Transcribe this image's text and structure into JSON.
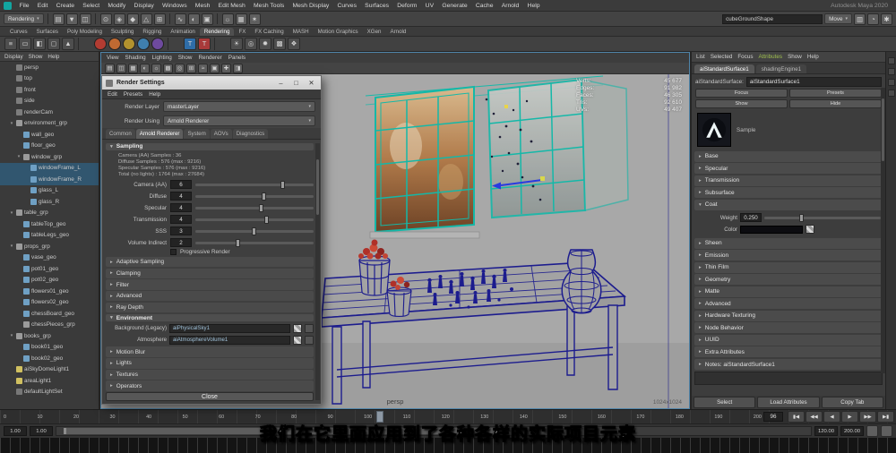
{
  "window": {
    "right_text": "Autodesk Maya 2020"
  },
  "subtitle": {
    "text": "我们在它里面应用到了各种各样的实际项目元素"
  },
  "menubar": {
    "items": [
      "File",
      "Edit",
      "Create",
      "Select",
      "Modify",
      "Display",
      "Windows",
      "Mesh",
      "Edit Mesh",
      "Mesh Tools",
      "Mesh Display",
      "Curves",
      "Surfaces",
      "Deform",
      "UV",
      "Generate",
      "Cache",
      "Arnold",
      "Help"
    ]
  },
  "statusline": {
    "menuset": "Rendering",
    "icons": [
      {
        "g": "▤",
        "c": "#5f5f5f"
      },
      {
        "g": "▼",
        "c": "#5f5f5f"
      },
      {
        "g": "◫",
        "c": "#5f5f5f"
      },
      {
        "cls": "sep"
      },
      {
        "g": "⊙",
        "c": "#5f5f5f"
      },
      {
        "g": "◈",
        "c": "#5f5f5f"
      },
      {
        "g": "◆",
        "c": "#5f5f5f"
      },
      {
        "g": "△",
        "c": "#5f5f5f"
      },
      {
        "g": "⊞",
        "c": "#5f5f5f"
      },
      {
        "cls": "sep"
      },
      {
        "g": "∿",
        "c": "#5f5f5f"
      },
      {
        "g": "◐",
        "c": "#5f5f5f"
      },
      {
        "g": "▣",
        "c": "#5f5f5f"
      },
      {
        "cls": "sep"
      },
      {
        "g": "☼",
        "c": "#5f5f5f"
      },
      {
        "g": "▦",
        "c": "#5f5f5f"
      },
      {
        "g": "✶",
        "c": "#5f5f5f"
      }
    ],
    "field_value": "cubeGroundShape",
    "tool_value": "Move",
    "icons2": [
      {
        "g": "▥",
        "c": "#5f5f5f"
      },
      {
        "g": "◔",
        "c": "#5f5f5f"
      },
      {
        "g": "✱",
        "c": "#5f5f5f"
      }
    ]
  },
  "shelf": {
    "tabs": [
      {
        "label": "Curves"
      },
      {
        "label": "Surfaces"
      },
      {
        "label": "Poly Modeling"
      },
      {
        "label": "Sculpting"
      },
      {
        "label": "Rigging"
      },
      {
        "label": "Animation"
      },
      {
        "label": "Rendering",
        "cls": "active"
      },
      {
        "label": "FX"
      },
      {
        "label": "FX Caching"
      },
      {
        "label": "MASH"
      },
      {
        "label": "Motion Graphics"
      },
      {
        "label": "XGen"
      },
      {
        "label": "Arnold"
      }
    ],
    "icons": [
      {
        "g": "≡",
        "c": "#4e4e4e"
      },
      {
        "g": "▭",
        "c": "#4e4e4e"
      },
      {
        "g": "◧",
        "c": "#4e4e4e"
      },
      {
        "g": "◻",
        "c": "#4e4e4e"
      },
      {
        "g": "▲",
        "c": "#4e4e4e"
      },
      {
        "cls": "sep"
      },
      {
        "g": "",
        "c": "#b23c32",
        "cls": "round"
      },
      {
        "g": "",
        "c": "#c06a32",
        "cls": "round"
      },
      {
        "g": "",
        "c": "#b2922e",
        "cls": "round"
      },
      {
        "g": "",
        "c": "#3f7fae",
        "cls": "round"
      },
      {
        "g": "",
        "c": "#6e4a9e",
        "cls": "round"
      },
      {
        "cls": "sep"
      },
      {
        "g": "T",
        "c": "#2f6da8"
      },
      {
        "g": "T",
        "c": "#a83a3a"
      },
      {
        "cls": "sep"
      },
      {
        "g": "☀",
        "c": "#4e4e4e"
      },
      {
        "g": "◎",
        "c": "#4e4e4e"
      },
      {
        "g": "✹",
        "c": "#4e4e4e"
      },
      {
        "g": "▩",
        "c": "#4e4e4e"
      },
      {
        "g": "❖",
        "c": "#4e4e4e"
      }
    ]
  },
  "outliner": {
    "menus": [
      "Display",
      "Show",
      "Help"
    ],
    "items": [
      {
        "label": "persp",
        "type": "camera",
        "ind": "6px",
        "tw": ""
      },
      {
        "label": "top",
        "type": "camera",
        "ind": "6px",
        "tw": ""
      },
      {
        "label": "front",
        "type": "camera",
        "ind": "6px",
        "tw": ""
      },
      {
        "label": "side",
        "type": "camera",
        "ind": "6px",
        "tw": ""
      },
      {
        "label": "renderCam",
        "type": "camera",
        "ind": "6px",
        "tw": ""
      },
      {
        "label": "environment_grp",
        "type": "transform",
        "ind": "6px",
        "tw": "▾"
      },
      {
        "label": "wall_geo",
        "type": "mesh",
        "ind": "14px",
        "tw": ""
      },
      {
        "label": "floor_geo",
        "type": "mesh",
        "ind": "14px",
        "tw": ""
      },
      {
        "label": "window_grp",
        "type": "transform",
        "ind": "14px",
        "tw": "▾"
      },
      {
        "label": "windowFrame_L",
        "type": "mesh",
        "ind": "22px",
        "tw": "",
        "cls": "sel"
      },
      {
        "label": "windowFrame_R",
        "type": "mesh",
        "ind": "22px",
        "tw": "",
        "cls": "sel"
      },
      {
        "label": "glass_L",
        "type": "mesh",
        "ind": "22px",
        "tw": ""
      },
      {
        "label": "glass_R",
        "type": "mesh",
        "ind": "22px",
        "tw": ""
      },
      {
        "label": "table_grp",
        "type": "transform",
        "ind": "6px",
        "tw": "▾"
      },
      {
        "label": "tableTop_geo",
        "type": "mesh",
        "ind": "14px",
        "tw": ""
      },
      {
        "label": "tableLegs_geo",
        "type": "mesh",
        "ind": "14px",
        "tw": ""
      },
      {
        "label": "props_grp",
        "type": "transform",
        "ind": "6px",
        "tw": "▾"
      },
      {
        "label": "vase_geo",
        "type": "mesh",
        "ind": "14px",
        "tw": ""
      },
      {
        "label": "pot01_geo",
        "type": "mesh",
        "ind": "14px",
        "tw": ""
      },
      {
        "label": "pot02_geo",
        "type": "mesh",
        "ind": "14px",
        "tw": ""
      },
      {
        "label": "flowers01_geo",
        "type": "mesh",
        "ind": "14px",
        "tw": ""
      },
      {
        "label": "flowers02_geo",
        "type": "mesh",
        "ind": "14px",
        "tw": ""
      },
      {
        "label": "chessBoard_geo",
        "type": "mesh",
        "ind": "14px",
        "tw": ""
      },
      {
        "label": "chessPieces_grp",
        "type": "transform",
        "ind": "14px",
        "tw": ""
      },
      {
        "label": "books_grp",
        "type": "transform",
        "ind": "6px",
        "tw": "▾"
      },
      {
        "label": "book01_geo",
        "type": "mesh",
        "ind": "14px",
        "tw": ""
      },
      {
        "label": "book02_geo",
        "type": "mesh",
        "ind": "14px",
        "tw": ""
      },
      {
        "label": "aiSkyDomeLight1",
        "type": "light",
        "ind": "6px",
        "tw": ""
      },
      {
        "label": "areaLight1",
        "type": "light",
        "ind": "6px",
        "tw": ""
      },
      {
        "label": "defaultLightSet",
        "type": "set",
        "ind": "6px",
        "tw": ""
      }
    ]
  },
  "render_settings": {
    "title": "Render Settings",
    "min": "–",
    "max": "□",
    "close": "✕",
    "menus": [
      "Edit",
      "Presets",
      "Help"
    ],
    "layer_label": "Render Layer",
    "layer_value": "masterLayer",
    "using_label": "Render Using",
    "using_value": "Arnold Renderer",
    "tabs": [
      {
        "label": "Common"
      },
      {
        "label": "Arnold Renderer",
        "cls": "active"
      },
      {
        "label": "System"
      },
      {
        "label": "AOVs"
      },
      {
        "label": "Diagnostics"
      }
    ],
    "sampling_header": "Sampling",
    "summary": [
      "Camera (AA) Samples : 36",
      "Diffuse Samples : 576 (max : 9216)",
      "Specular Samples : 576 (max : 9216)",
      "Total (no lights) : 1764 (max : 27684)"
    ],
    "sliders": [
      {
        "label": "Camera (AA)",
        "value": "6",
        "pos": "72%"
      },
      {
        "label": "Diffuse",
        "value": "4",
        "pos": "56%"
      },
      {
        "label": "Specular",
        "value": "4",
        "pos": "54%"
      },
      {
        "label": "Transmission",
        "value": "4",
        "pos": "58%"
      },
      {
        "label": "SSS",
        "value": "3",
        "pos": "48%"
      },
      {
        "label": "Volume Indirect",
        "value": "2",
        "pos": "34%"
      }
    ],
    "progressive_label": "Progressive Render",
    "sections_a": [
      {
        "label": "Adaptive Sampling"
      },
      {
        "label": "Clamping"
      },
      {
        "label": "Filter"
      },
      {
        "label": "Advanced"
      },
      {
        "label": "Ray Depth"
      }
    ],
    "environment_header": "Environment",
    "env_rows": [
      {
        "label": "Background (Legacy)",
        "value": "aiPhysicalSky1"
      },
      {
        "label": "Atmosphere",
        "value": "aiAtmosphereVolume1"
      }
    ],
    "sections_b": [
      {
        "label": "Motion Blur"
      },
      {
        "label": "Lights"
      },
      {
        "label": "Textures"
      },
      {
        "label": "Operators"
      }
    ],
    "close_label": "Close"
  },
  "viewport": {
    "menus": [
      "View",
      "Shading",
      "Lighting",
      "Show",
      "Renderer",
      "Panels"
    ],
    "icons": [
      {
        "g": "▤"
      },
      {
        "g": "◫"
      },
      {
        "g": "▦"
      },
      {
        "g": "◐"
      },
      {
        "g": "☼"
      },
      {
        "g": "▩"
      },
      {
        "g": "◎"
      },
      {
        "g": "⊞"
      },
      {
        "g": "≈"
      },
      {
        "g": "▣"
      },
      {
        "g": "✚"
      },
      {
        "g": "◨"
      }
    ],
    "hud": [
      {
        "label": "Verts:",
        "value": "45 677"
      },
      {
        "label": "Edges:",
        "value": "91 982"
      },
      {
        "label": "Faces:",
        "value": "46 305"
      },
      {
        "label": "Tris:",
        "value": "92 610"
      },
      {
        "label": "UVs:",
        "value": "49 407"
      }
    ],
    "camera_label": "persp",
    "gate_label": "1024x1024"
  },
  "attribute_editor": {
    "menus": [
      {
        "label": "List"
      },
      {
        "label": "Selected"
      },
      {
        "label": "Focus"
      },
      {
        "label": "Attributes",
        "cls": "green"
      },
      {
        "label": "Show"
      },
      {
        "label": "Help"
      }
    ],
    "tabs": [
      {
        "label": "aiStandardSurface1",
        "cls": "active"
      },
      {
        "label": "shadingEngine1"
      }
    ],
    "name_label": "aiStandardSurface:",
    "name_value": "aiStandardSurface1",
    "buttons": [
      "Focus",
      "Presets",
      "Show",
      "Hide"
    ],
    "swatch_label": "Sample",
    "sections_a": [
      {
        "label": "Base"
      },
      {
        "label": "Specular"
      },
      {
        "label": "Transmission"
      },
      {
        "label": "Subsurface"
      }
    ],
    "expanded_label": "Coat",
    "weight_label": "Weight",
    "weight_value": "0.250",
    "weight_pos": "30%",
    "color_label": "Color",
    "sections_b": [
      {
        "label": "Sheen"
      },
      {
        "label": "Emission"
      },
      {
        "label": "Thin Film"
      },
      {
        "label": "Geometry"
      },
      {
        "label": "Matte"
      },
      {
        "label": "Advanced"
      },
      {
        "label": "Hardware Texturing"
      },
      {
        "label": "Node Behavior"
      },
      {
        "label": "UUID"
      },
      {
        "label": "Extra Attributes"
      }
    ],
    "notes_label": "Notes: aiStandardSurface1",
    "footer": [
      "Select",
      "Load Attributes",
      "Copy Tab"
    ]
  },
  "timeline": {
    "ticks": [
      "0",
      "10",
      "20",
      "30",
      "40",
      "50",
      "60",
      "70",
      "80",
      "90",
      "100",
      "110",
      "120",
      "130",
      "140",
      "150",
      "160",
      "170",
      "180",
      "190",
      "200"
    ],
    "current": "96",
    "transport": [
      "▮◀",
      "◀◀",
      "◀",
      "▶",
      "▶▶",
      "▶▮"
    ],
    "range": {
      "a": "1.00",
      "b": "1.00",
      "c": "120.00",
      "d": "200.00"
    }
  }
}
